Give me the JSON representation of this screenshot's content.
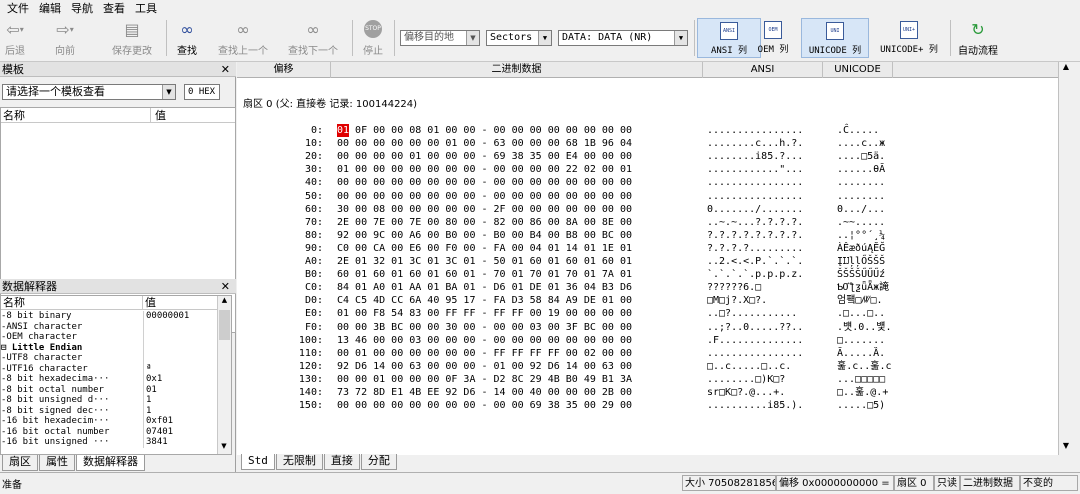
{
  "menu": [
    "文件",
    "编辑",
    "导航",
    "查看",
    "工具"
  ],
  "toolbar": {
    "back": "后退",
    "forward": "向前",
    "save": "保存更改",
    "find": "查找",
    "find_prev": "查找上一个",
    "find_next": "查找下一个",
    "stop": "停止",
    "offset_target": "偏移目的地",
    "unit": "Sectors",
    "data_source": "DATA: DATA (NR)",
    "ansi_col": "ANSI 列",
    "oem_col": "OEM 列",
    "unicode_col": "UNICODE 列",
    "unicode_plus_col": "UNICODE+ 列",
    "auto_flow": "自动流程",
    "ansi_icon_text": "ANSI",
    "oem_icon_text": "OEM",
    "uni_icon_text": "UNI",
    "uniplus_icon_text": "UNI+"
  },
  "templates": {
    "title": "模板",
    "select_placeholder": "请选择一个模板查看",
    "hex_value": "0 HEX",
    "col_name": "名称",
    "col_value": "值"
  },
  "interpreter": {
    "title": "数据解释器",
    "col_name": "名称",
    "col_value": "值",
    "rows": [
      {
        "name": "-8 bit binary",
        "value": "00000001"
      },
      {
        "name": "-ANSI character",
        "value": ""
      },
      {
        "name": "-OEM character",
        "value": ""
      },
      {
        "name": "⊟ Little Endian",
        "value": ""
      },
      {
        "name": "  -UTF8 character",
        "value": ""
      },
      {
        "name": "  -UTF16 character",
        "value": "ª"
      },
      {
        "name": "  -8 bit hexadecima···",
        "value": "0x1"
      },
      {
        "name": "  -8 bit octal number",
        "value": "01"
      },
      {
        "name": "  -8 bit unsigned d···",
        "value": "1"
      },
      {
        "name": "  -8 bit signed dec···",
        "value": "1"
      },
      {
        "name": "  -16 bit hexadecim···",
        "value": "0xf01"
      },
      {
        "name": "  -16 bit octal number",
        "value": "07401"
      },
      {
        "name": "  -16 bit unsigned ···",
        "value": "3841"
      }
    ]
  },
  "left_tabs": [
    "扇区",
    "属性",
    "数据解释器"
  ],
  "hex_header": {
    "offset": "偏移",
    "binary": "二进制数据",
    "ansi": "ANSI",
    "unicode": "UNICODE"
  },
  "sector_line": "扇区 0 (父: 直接卷 记录: 100144224)",
  "first_byte": "01",
  "hex_rows": [
    {
      "off": "0:",
      "hex": "   0F 00 00 08 01 00 00 - 00 00 00 00 00 00 00 00",
      "ansi": "................",
      "uni": ".Ĉ....."
    },
    {
      "off": "10:",
      "hex": "00 00 00 00 00 00 01 00 - 63 00 00 00 68 1B 96 04",
      "ansi": "........c...h.?.",
      "uni": "....c..ж"
    },
    {
      "off": "20:",
      "hex": "00 00 00 00 01 00 00 00 - 69 38 35 00 E4 00 00 00",
      "ansi": "........i85.?...",
      "uni": "....□5ä."
    },
    {
      "off": "30:",
      "hex": "01 00 00 00 00 00 00 00 - 00 00 00 00 22 02 00 01",
      "ansi": "............\"...",
      "uni": "......θĀ"
    },
    {
      "off": "40:",
      "hex": "00 00 00 00 00 00 00 00 - 00 00 00 00 00 00 00 00",
      "ansi": "................",
      "uni": "........"
    },
    {
      "off": "50:",
      "hex": "00 00 00 00 00 00 00 00 - 00 00 00 00 00 00 00 00",
      "ansi": "................",
      "uni": "........"
    },
    {
      "off": "60:",
      "hex": "30 00 08 00 00 00 00 00 - 2F 00 00 00 00 00 00 00",
      "ansi": "0......./.......",
      "uni": "0.../..."
    },
    {
      "off": "70:",
      "hex": "2E 00 7E 00 7E 00 80 00 - 82 00 86 00 8A 00 8E 00",
      "ansi": "..~.~...?.?.?.?.",
      "uni": ".~~....."
    },
    {
      "off": "80:",
      "hex": "92 00 9C 00 A6 00 B0 00 - B0 00 B4 00 B8 00 BC 00",
      "ansi": "?.?.?.?.?.?.?.?.",
      "uni": "..¦°°´¸¼"
    },
    {
      "off": "90:",
      "hex": "C0 00 CA 00 E6 00 F0 00 - FA 00 04 01 14 01 1E 01",
      "ansi": "?.?.?.?.........",
      "uni": "ÀÊæðúĄĔĞ"
    },
    {
      "off": "A0:",
      "hex": "2E 01 32 01 3C 01 3C 01 - 50 01 60 01 60 01 60 01",
      "ansi": "..2.<.<.P.`.`.`.",
      "uni": "ĮĲļļŐŠŠŠ"
    },
    {
      "off": "B0:",
      "hex": "60 01 60 01 60 01 60 01 - 70 01 70 01 70 01 7A 01",
      "ansi": "`.`.`.`.p.p.p.z.",
      "uni": "ŠŠŠŠŰŰŰź"
    },
    {
      "off": "C0:",
      "hex": "84 01 A0 01 AA 01 BA 01 - D6 01 DE 01 36 04 B3 D6",
      "ansi": "??????6.□",
      "uni": "ƄƠƪƺǖǞж䛳"
    },
    {
      "off": "D0:",
      "hex": "C4 C5 4D CC 6A 40 95 17 - FA D3 58 84 A9 DE 01 00",
      "ansi": "□M□j?.X□?.",
      "uni": "엄퍸□ꥄ□."
    },
    {
      "off": "E0:",
      "hex": "01 00 F8 54 83 00 FF FF - FF FF 00 19 00 00 00 00",
      "ansi": "..□?...........",
      "uni": ".□...□.."
    },
    {
      "off": "F0:",
      "hex": "00 00 3B BC 00 00 30 00 - 00 00 03 00 3F BC 00 00",
      "ansi": "..;?..0.....??..",
      "uni": ".뱻.0..뱿."
    },
    {
      "off": "100:",
      "hex": "13 46 00 00 03 00 00 00 - 00 00 00 00 00 00 00 00",
      "ansi": ".F..............",
      "uni": "□......."
    },
    {
      "off": "110:",
      "hex": "00 01 00 00 00 00 00 00 - FF FF FF FF 00 02 00 00",
      "ansi": "................",
      "uni": "Ā.....Ȁ."
    },
    {
      "off": "120:",
      "hex": "92 D6 14 00 63 00 00 00 - 01 00 92 D6 14 00 63 00",
      "ansi": "□..c.....□..c.",
      "uni": "훒.c..훒.c"
    },
    {
      "off": "130:",
      "hex": "00 00 01 00 00 00 0F 3A - D2 8C 29 4B B0 49 B1 3A",
      "ansi": "........□)K□?",
      "uni": "...□□□□□"
    },
    {
      "off": "140:",
      "hex": "73 72 8D E1 4B EE 92 D6 - 14 00 40 00 00 00 2B 00",
      "ansi": "sr□K□?.@...+.",
      "uni": "□..훒.@.+"
    },
    {
      "off": "150:",
      "hex": "00 00 00 00 00 00 00 00 - 00 00 69 38 35 00 29 00",
      "ansi": "..........i85.).",
      "uni": ".....□5)"
    }
  ],
  "bottom_tabs": [
    "Std",
    "无限制",
    "直接",
    "分配"
  ],
  "status": {
    "ready": "准备",
    "size": "大小 70508281856",
    "offset": "偏移 0x0000000000 = 0",
    "sector": "扇区 0",
    "readonly": "只读",
    "binary": "二进制数据",
    "mode": "不变的"
  }
}
